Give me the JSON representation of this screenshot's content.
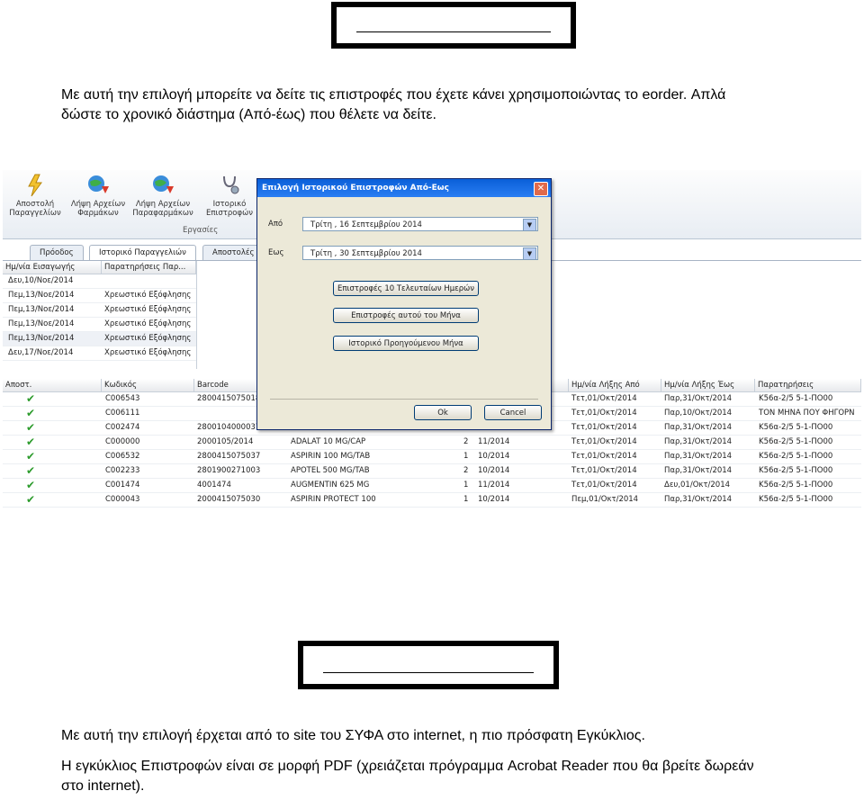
{
  "section1": {
    "paragraph_line1": "Με αυτή την επιλογή μπορείτε να δείτε τις επιστροφές που έχετε κάνει χρησιμοποιώντας το eorder. Απλά",
    "paragraph_line2": "δώστε το χρονικό διάστημα (Από-έως) που θέλετε να δείτε."
  },
  "app": {
    "ribbon": {
      "buttons": [
        "Αποστολή Παραγγελίων",
        "Λήψη Αρχείων Φαρμάκων",
        "Λήψη Αρχείων Παραφαρμάκων",
        "Ιστορικό Επιστροφών"
      ],
      "group_label": "Εργασίες"
    },
    "tabs": [
      "Πρόοδος",
      "Ιστορικό Παραγγελιών",
      "Αποστολές"
    ],
    "upper_table": {
      "headers": [
        "Ημ/νία Εισαγωγής",
        "Παρατηρήσεις Παρ..."
      ],
      "rows": [
        [
          "Δευ,10/Νοε/2014",
          ""
        ],
        [
          "Πεμ,13/Νοε/2014",
          "Χρεωστικό Εξόφλησης"
        ],
        [
          "Πεμ,13/Νοε/2014",
          "Χρεωστικό Εξόφλησης"
        ],
        [
          "Πεμ,13/Νοε/2014",
          "Χρεωστικό Εξόφλησης"
        ],
        [
          "Πεμ,13/Νοε/2014",
          "Χρεωστικό Εξόφλησης"
        ],
        [
          "Δευ,17/Νοε/2014",
          "Χρεωστικό Εξόφλησης"
        ]
      ]
    },
    "lower_table": {
      "headers": [
        "Αποστ.",
        "Κωδικός",
        "Barcode",
        "Ημ/νία Λήξης Από",
        "Ημ/νία Λήξης Έως",
        "Παρατηρήσεις"
      ],
      "rows": [
        {
          "code": "C006543",
          "barcode": "2800415075018",
          "desc": "",
          "qty": "",
          "date": "",
          "from": "Τετ,01/Οκτ/2014",
          "to": "Παρ,31/Οκτ/2014",
          "note": "Κ56α-2/5 5-1-ΠΟ00"
        },
        {
          "code": "C006111",
          "barcode": "",
          "desc": "",
          "qty": "",
          "date": "",
          "from": "Τετ,01/Οκτ/2014",
          "to": "Παρ,10/Οκτ/2014",
          "note": "ΤΟΝ ΜΗΝΑ ΠΟΥ ΦΗΓΟΡΝ"
        },
        {
          "code": "C002474",
          "barcode": "2800104000037",
          "desc": "",
          "qty": "",
          "date": "",
          "from": "Τετ,01/Οκτ/2014",
          "to": "Παρ,31/Οκτ/2014",
          "note": "Κ56α-2/5 5-1-ΠΟ00"
        },
        {
          "code": "C000000",
          "barcode": "2000105/2014",
          "desc": "ADALAT 10 MG/CAP",
          "qty": "2",
          "date": "11/2014",
          "from": "Τετ,01/Οκτ/2014",
          "to": "Παρ,31/Οκτ/2014",
          "note": "Κ56α-2/5 5-1-ΠΟ00"
        },
        {
          "code": "C006532",
          "barcode": "2800415075037",
          "desc": "ASPIRIN 100 MG/TAB",
          "qty": "1",
          "date": "10/2014",
          "from": "Τετ,01/Οκτ/2014",
          "to": "Παρ,31/Οκτ/2014",
          "note": "Κ56α-2/5 5-1-ΠΟ00"
        },
        {
          "code": "C002233",
          "barcode": "2801900271003",
          "desc": "APOTEL 500 MG/TAB",
          "qty": "2",
          "date": "10/2014",
          "from": "Τετ,01/Οκτ/2014",
          "to": "Παρ,31/Οκτ/2014",
          "note": "Κ56α-2/5 5-1-ΠΟ00"
        },
        {
          "code": "C001474",
          "barcode": "4001474",
          "desc": "AUGMENTIN 625 MG",
          "qty": "1",
          "date": "11/2014",
          "from": "Τετ,01/Οκτ/2014",
          "to": "Δευ,01/Οκτ/2014",
          "note": "Κ56α-2/5 5-1-ΠΟ00"
        },
        {
          "code": "C000043",
          "barcode": "2000415075030",
          "desc": "ASPIRIN PROTECT 100",
          "qty": "1",
          "date": "10/2014",
          "from": "Πεμ,01/Οκτ/2014",
          "to": "Παρ,31/Οκτ/2014",
          "note": "Κ56α-2/5 5-1-ΠΟ00"
        }
      ]
    },
    "dialog": {
      "title": "Επιλογή Ιστορικού Επιστροφών Από-Εως",
      "from_label": "Από",
      "to_label": "Εως",
      "from_value": "Τρίτη , 16  Σεπτεμβρίου 2014",
      "to_value": "Τρίτη , 30  Σεπτεμβρίου 2014",
      "btn1": "Επιστροφές 10 Τελευταίων Ημερών",
      "btn2": "Επιστροφές αυτού του Μήνα",
      "btn3": "Ιστορικό Προηγούμενου Μήνα",
      "ok": "Ok",
      "cancel": "Cancel"
    }
  },
  "section2": {
    "line1": "Με αυτή την επιλογή έρχεται από το site του ΣΥΦΑ στο internet, η πιο πρόσφατη Εγκύκλιος.",
    "line2": "Η εγκύκλιος Επιστροφών είναι σε μορφή PDF (χρειάζεται πρόγραμμα Acrobat Reader που θα βρείτε δωρεάν",
    "line3": "στο internet)."
  }
}
